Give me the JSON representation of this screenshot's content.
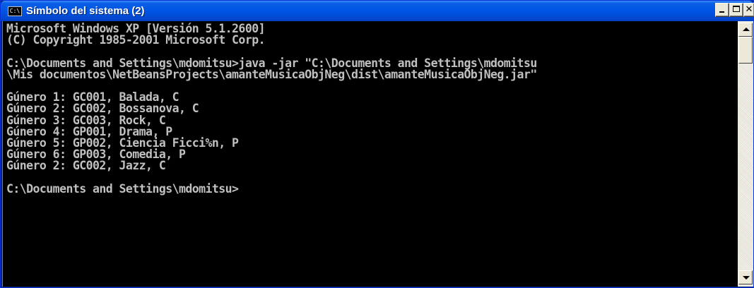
{
  "window": {
    "title": "Símbolo del sistema (2)",
    "icon_label": "C:\\",
    "controls": {
      "minimize_label": "_",
      "maximize_label": "□",
      "close_label": "✕"
    }
  },
  "console": {
    "lines": [
      "Microsoft Windows XP [Versión 5.1.2600]",
      "(C) Copyright 1985-2001 Microsoft Corp.",
      "",
      "C:\\Documents and Settings\\mdomitsu>java -jar \"C:\\Documents and Settings\\mdomitsu",
      "\\Mis documentos\\NetBeansProjects\\amanteMusicaObjNeg\\dist\\amanteMusicaObjNeg.jar\"",
      "",
      "Gúnero 1: GC001, Balada, C",
      "Gúnero 2: GC002, Bossanova, C",
      "Gúnero 3: GC003, Rock, C",
      "Gúnero 4: GP001, Drama, P",
      "Gúnero 5: GP002, Ciencia Ficci%n, P",
      "Gúnero 6: GP003, Comedia, P",
      "Gúnero 2: GC002, Jazz, C",
      "",
      "C:\\Documents and Settings\\mdomitsu>"
    ]
  },
  "colors": {
    "titlebar": "#0054e3",
    "console_background": "#000000",
    "console_text": "#c0c0c0"
  },
  "icons": {
    "app": "cmd-icon",
    "minimize": "minimize-icon",
    "maximize": "maximize-icon",
    "close": "close-icon",
    "scroll_up": "arrow-up-icon",
    "scroll_down": "arrow-down-icon"
  }
}
